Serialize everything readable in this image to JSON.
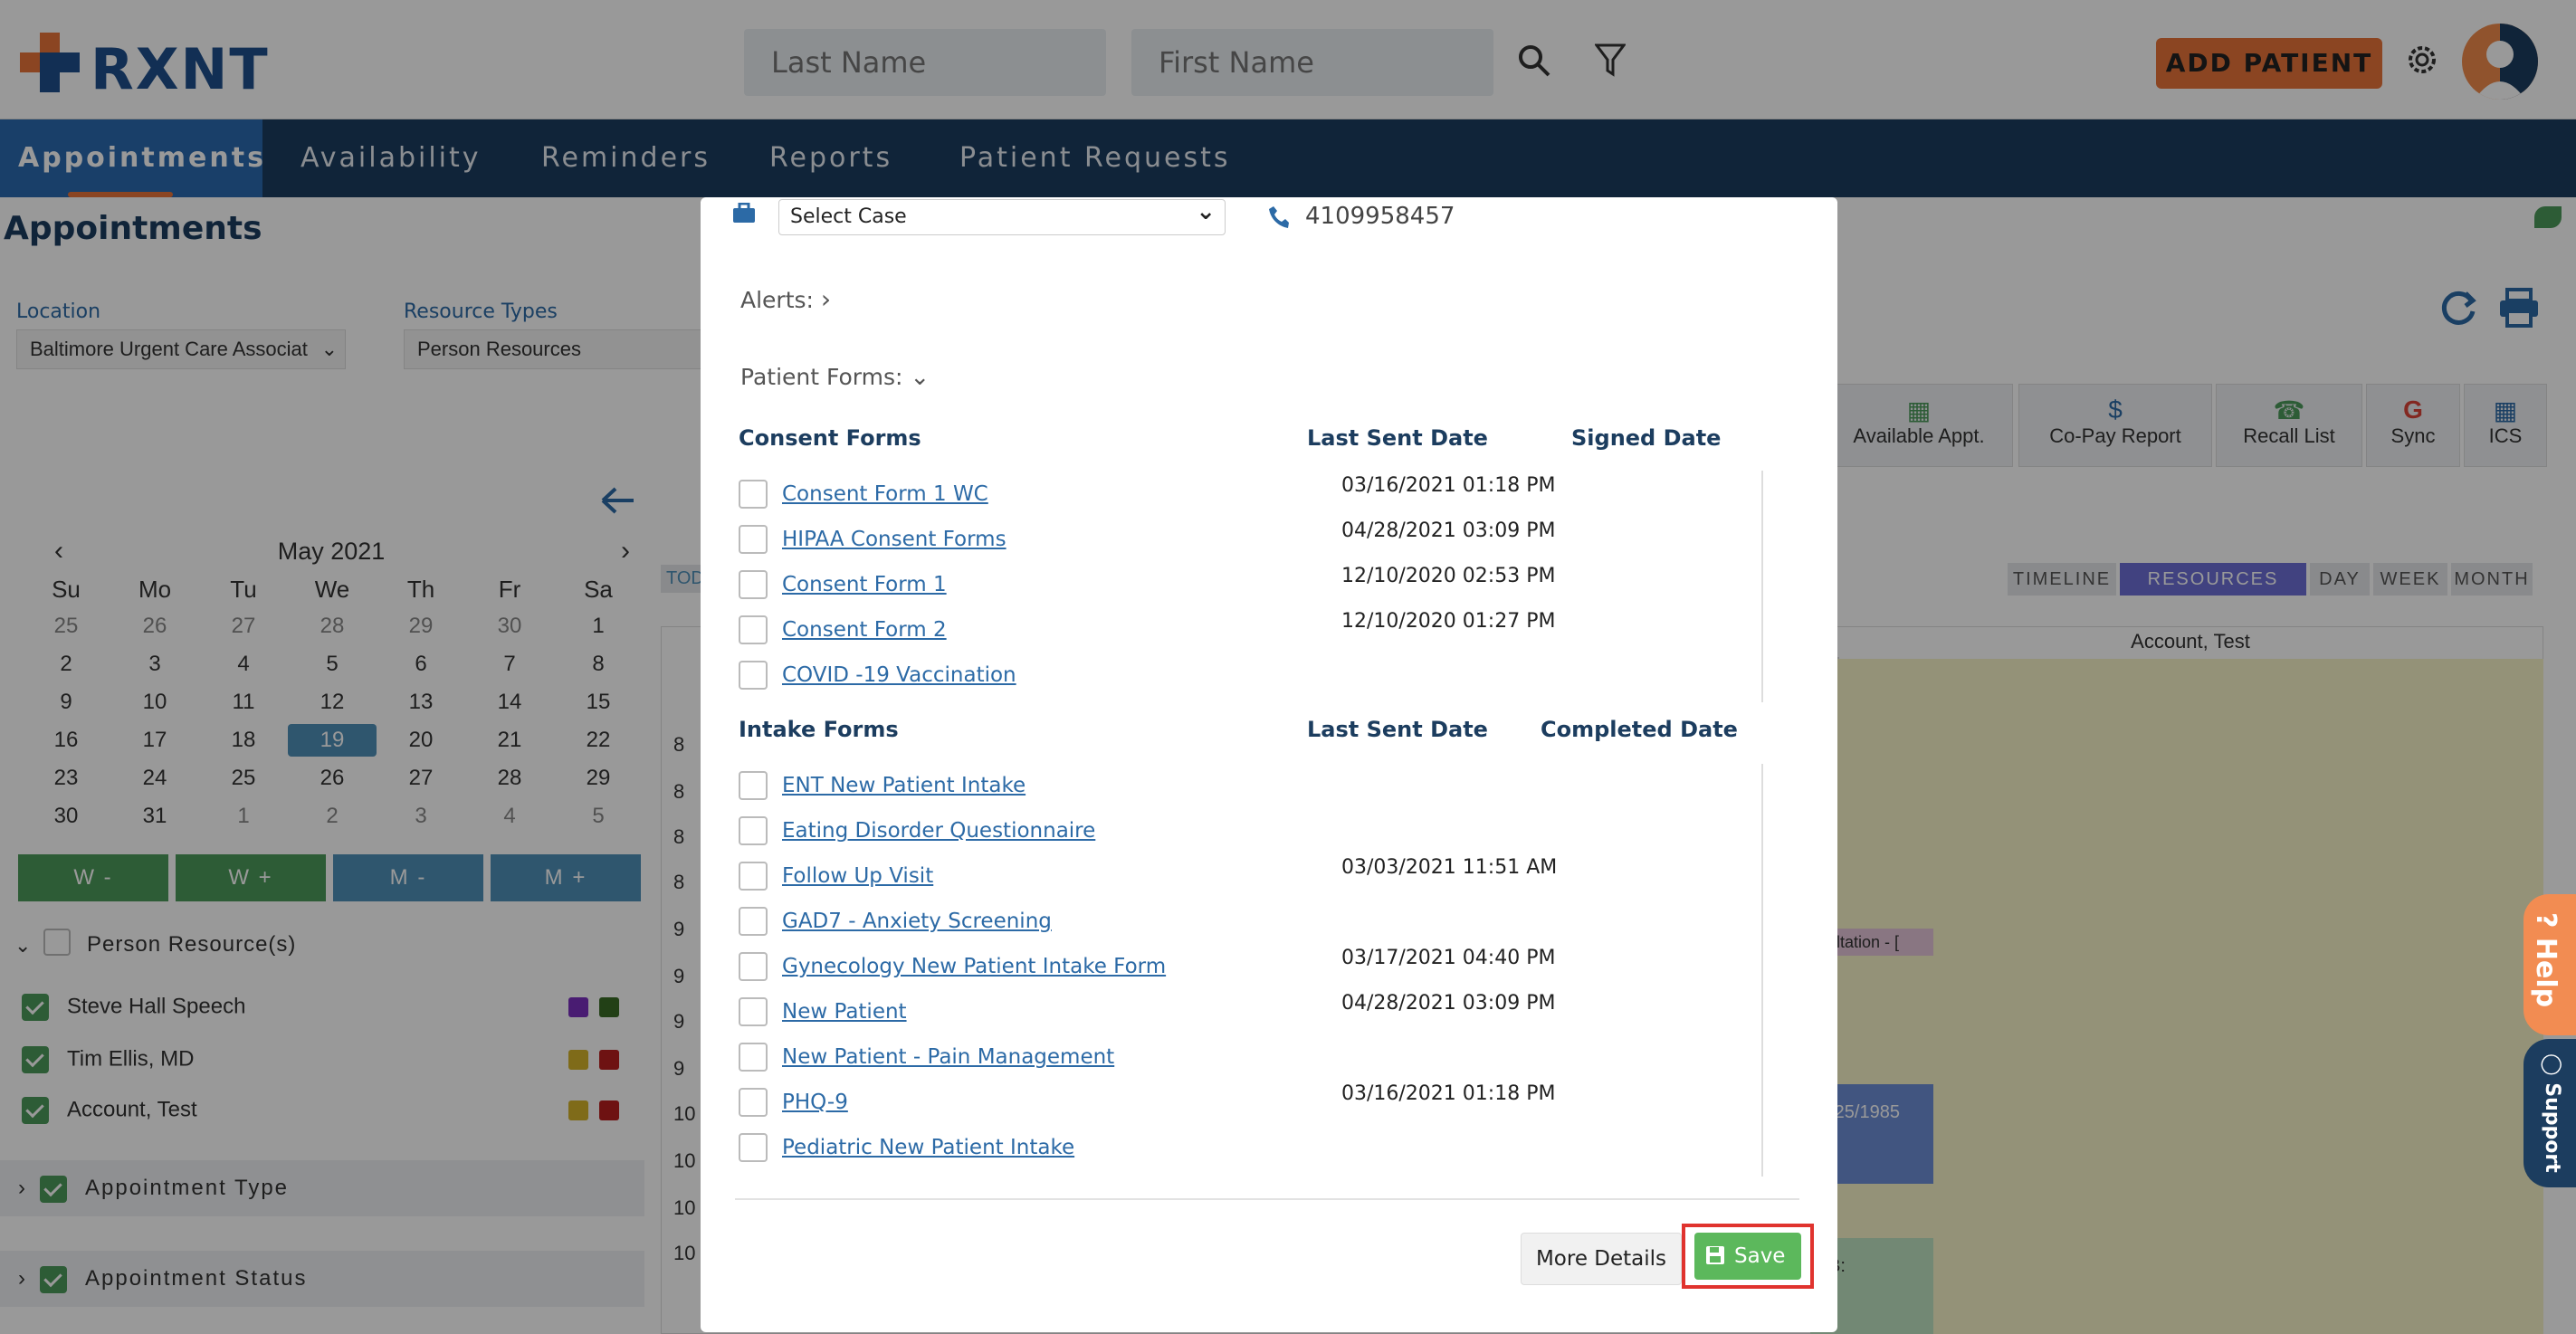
{
  "header": {
    "logo_text": "RXNT",
    "last_name_placeholder": "Last Name",
    "first_name_placeholder": "First Name",
    "add_patient_label": "ADD PATIENT"
  },
  "nav": {
    "items": [
      {
        "label": "Appointments",
        "active": true
      },
      {
        "label": "Availability"
      },
      {
        "label": "Reminders"
      },
      {
        "label": "Reports"
      },
      {
        "label": "Patient Requests"
      }
    ]
  },
  "page": {
    "title": "Appointments",
    "location_label": "Location",
    "location_value": "Baltimore Urgent Care Associat",
    "resource_types_label": "Resource Types",
    "resource_types_value": "Person Resources",
    "calendar": {
      "month": "May 2021",
      "weekdays": [
        "Su",
        "Mo",
        "Tu",
        "We",
        "Th",
        "Fr",
        "Sa"
      ],
      "weeks": [
        [
          "25",
          "26",
          "27",
          "28",
          "29",
          "30",
          "1"
        ],
        [
          "2",
          "3",
          "4",
          "5",
          "6",
          "7",
          "8"
        ],
        [
          "9",
          "10",
          "11",
          "12",
          "13",
          "14",
          "15"
        ],
        [
          "16",
          "17",
          "18",
          "19",
          "20",
          "21",
          "22"
        ],
        [
          "23",
          "24",
          "25",
          "26",
          "27",
          "28",
          "29"
        ],
        [
          "30",
          "31",
          "1",
          "2",
          "3",
          "4",
          "5"
        ]
      ],
      "selected": "19"
    },
    "wm_buttons": [
      "W -",
      "W +",
      "M -",
      "M +"
    ],
    "person_resources_label": "Person Resource(s)",
    "resources": [
      {
        "name": "Steve Hall Speech"
      },
      {
        "name": "Tim Ellis, MD"
      },
      {
        "name": "Account, Test"
      }
    ],
    "appointment_type_label": "Appointment Type",
    "appointment_status_label": "Appointment Status",
    "tools": [
      "Available Appt.",
      "Co-Pay Report",
      "Recall List",
      "Sync",
      "ICS"
    ],
    "views": [
      "TIMELINE",
      "RESOURCES VIEW",
      "DAY",
      "WEEK",
      "MONTH"
    ],
    "active_view": "RESOURCES VIEW",
    "column_header": "Account, Test",
    "today_fragment": "TOD",
    "time_fragments": [
      "8",
      "8",
      "8",
      "8",
      "9",
      "9",
      "9",
      "9",
      "10",
      "10",
      "10",
      "10"
    ],
    "appt_fragments": [
      "sultation - [",
      "2/25/1985",
      "B:"
    ]
  },
  "modal": {
    "case_select": "Select Case",
    "phone": "4109958457",
    "alerts_label": "Alerts:",
    "patient_forms_label": "Patient Forms:",
    "consent_header": {
      "title": "Consent Forms",
      "col1": "Last Sent Date",
      "col2": "Signed Date"
    },
    "consent_forms": [
      {
        "name": "Consent Form 1 WC",
        "last_sent": "03/16/2021 01:18 PM"
      },
      {
        "name": "HIPAA Consent Forms",
        "last_sent": "04/28/2021 03:09 PM"
      },
      {
        "name": "Consent Form 1",
        "last_sent": "12/10/2020 02:53 PM"
      },
      {
        "name": "Consent Form 2",
        "last_sent": "12/10/2020 01:27 PM"
      },
      {
        "name": "COVID -19 Vaccination",
        "last_sent": ""
      }
    ],
    "intake_header": {
      "title": "Intake Forms",
      "col1": "Last Sent Date",
      "col2": "Completed Date"
    },
    "intake_forms": [
      {
        "name": "ENT New Patient Intake",
        "last_sent": ""
      },
      {
        "name": "Eating Disorder Questionnaire",
        "last_sent": ""
      },
      {
        "name": "Follow Up Visit",
        "last_sent": "03/03/2021 11:51 AM"
      },
      {
        "name": "GAD7 - Anxiety Screening",
        "last_sent": ""
      },
      {
        "name": "Gynecology New Patient Intake Form",
        "last_sent": "03/17/2021 04:40 PM"
      },
      {
        "name": "New Patient",
        "last_sent": "04/28/2021 03:09 PM"
      },
      {
        "name": "New Patient - Pain Management",
        "last_sent": ""
      },
      {
        "name": "PHQ-9",
        "last_sent": "03/16/2021 01:18 PM"
      },
      {
        "name": "Pediatric New Patient Intake",
        "last_sent": ""
      }
    ],
    "more_details_label": "More Details",
    "save_label": "Save"
  },
  "side_tabs": {
    "help": "Help",
    "support": "Support"
  },
  "colors": {
    "navy": "#1c3d5f",
    "accent_orange": "#e8743a",
    "link_blue": "#2c6aa6",
    "save_green": "#5cb85c",
    "highlight_red": "#e0332e"
  }
}
